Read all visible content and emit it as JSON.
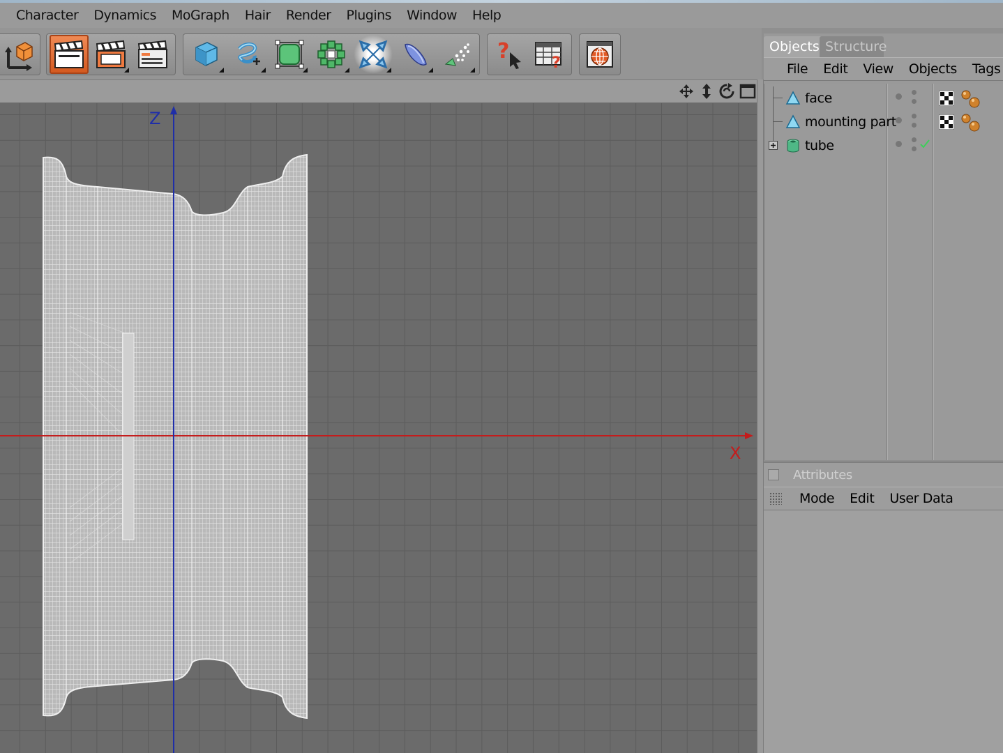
{
  "menubar": {
    "items": [
      "Character",
      "Dynamics",
      "MoGraph",
      "Hair",
      "Render",
      "Plugins",
      "Window",
      "Help"
    ]
  },
  "toolbar": {
    "icons": [
      "axis-icon",
      "render-view-icon",
      "render-picture-viewer-icon",
      "edit-render-settings-icon",
      "cube-icon",
      "spline-pen-icon",
      "subdivision-surface-icon",
      "array-icon",
      "deformer-icon",
      "floor-icon",
      "particle-emitter-icon",
      "help-pointer-icon",
      "timeline-help-icon",
      "web-icon"
    ],
    "active_icon": "render-view-icon",
    "accent_color": "#e8743e"
  },
  "viewport": {
    "axis_z_label": "Z",
    "axis_x_label": "X",
    "axis_z_color": "#1f2ea8",
    "axis_x_color": "#c41c1c",
    "nav_icons": [
      "move-icon",
      "zoom-icon",
      "rotate-icon",
      "maximize-icon"
    ]
  },
  "objects_panel": {
    "tabs": [
      "Objects",
      "Structure"
    ],
    "active_tab": "Objects",
    "menu": [
      "File",
      "Edit",
      "View",
      "Objects",
      "Tags"
    ],
    "objects": [
      {
        "name": "face",
        "icon": "polygon-object-icon",
        "has_material_tag": true,
        "has_phong_tag": true
      },
      {
        "name": "mounting part",
        "icon": "polygon-object-icon",
        "has_material_tag": true,
        "has_phong_tag": true
      },
      {
        "name": "tube",
        "icon": "tube-object-icon",
        "expandable": true,
        "checkmark": true
      }
    ]
  },
  "attributes_panel": {
    "title": "Attributes",
    "menu": [
      "Mode",
      "Edit",
      "User Data"
    ]
  }
}
